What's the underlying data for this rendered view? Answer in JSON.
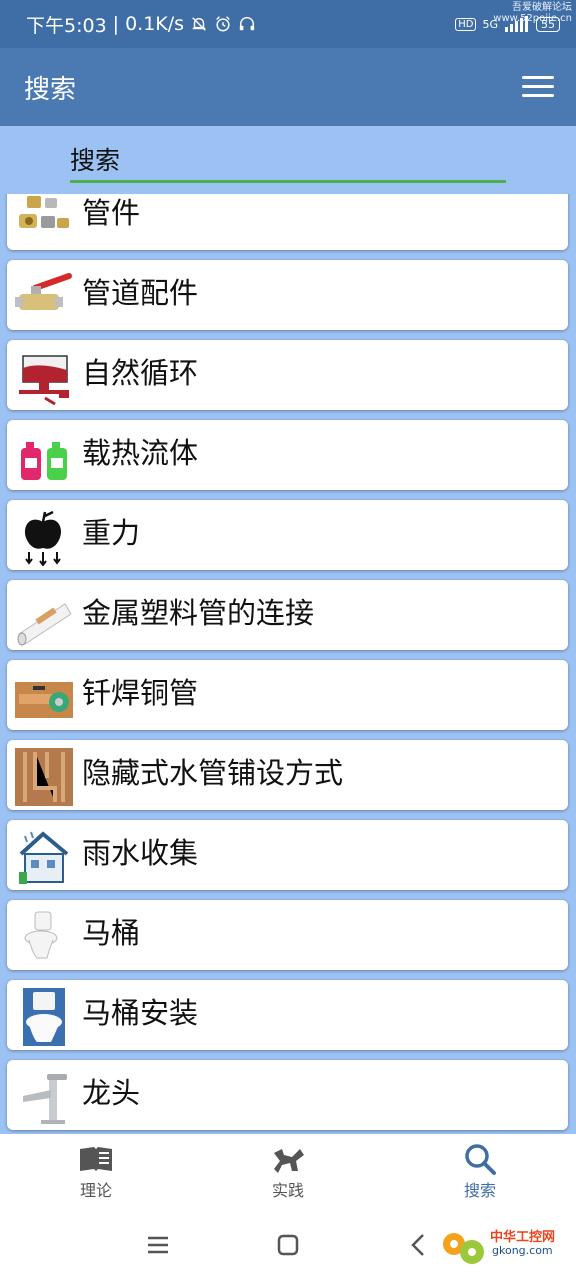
{
  "status_bar": {
    "time": "下午5:03",
    "speed": "0.1K/s",
    "hd": "HD",
    "network": "5G",
    "battery": "55",
    "watermark_top": "吾爱破解论坛",
    "watermark_url": "www.52pojie.cn"
  },
  "app_bar": {
    "title": "搜索",
    "menu_icon": "hamburger-menu-icon"
  },
  "search": {
    "placeholder": "搜索"
  },
  "items": [
    {
      "label": "管件",
      "icon": "fittings-icon"
    },
    {
      "label": "管道配件",
      "icon": "ball-valve-icon"
    },
    {
      "label": "自然循环",
      "icon": "natural-circulation-icon"
    },
    {
      "label": "载热流体",
      "icon": "heat-fluid-bottles-icon"
    },
    {
      "label": "重力",
      "icon": "apple-gravity-icon"
    },
    {
      "label": "金属塑料管的连接",
      "icon": "metal-plastic-pipe-icon"
    },
    {
      "label": "钎焊铜管",
      "icon": "solder-copper-pipe-icon"
    },
    {
      "label": "隐藏式水管铺设方式",
      "icon": "hidden-pipes-icon"
    },
    {
      "label": "雨水收集",
      "icon": "rainwater-house-icon"
    },
    {
      "label": "马桶",
      "icon": "toilet-icon"
    },
    {
      "label": "马桶安装",
      "icon": "toilet-install-icon"
    },
    {
      "label": "龙头",
      "icon": "faucet-icon"
    }
  ],
  "bottom_nav": {
    "theory": "理论",
    "practice": "实践",
    "search": "搜索"
  },
  "watermark_bottom": {
    "text": "中华工控网",
    "url": "gkong.com"
  },
  "colors": {
    "status_bar": "#3f6ea6",
    "app_bar": "#4b7ab2",
    "background": "#9cc2f4",
    "search_underline": "#4caf50",
    "active_nav": "#3f6ea6"
  }
}
